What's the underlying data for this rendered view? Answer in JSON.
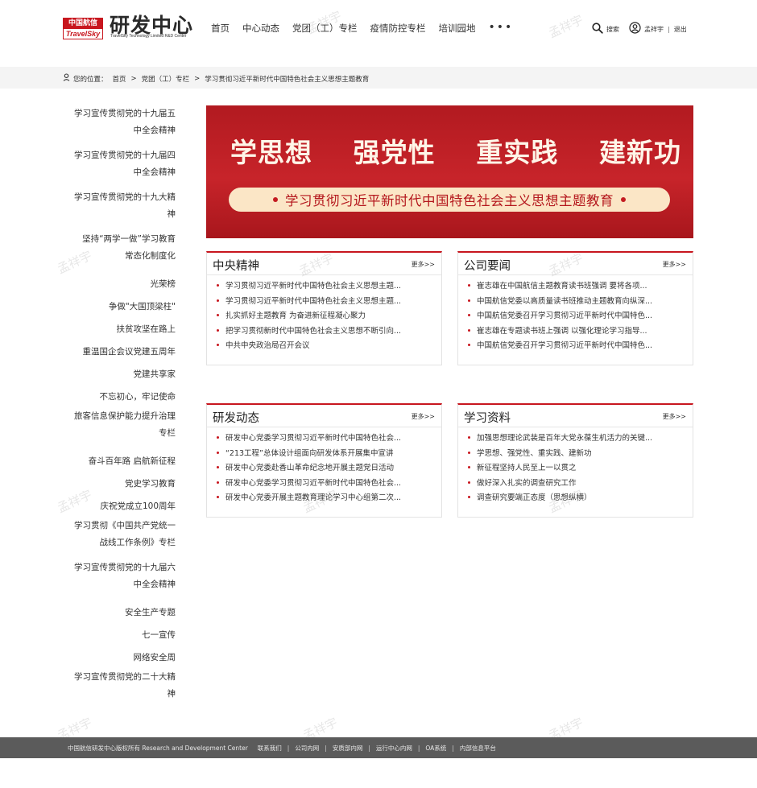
{
  "header": {
    "logo_top": "中国航信",
    "logo_bottom": "TravelSky",
    "brand_title": "研发中心",
    "brand_subtitle": "TravelSky Technology Limited R&D Center",
    "nav": [
      "首页",
      "中心动态",
      "党团（工）专栏",
      "疫情防控专栏",
      "培训园地"
    ],
    "nav_more": "•••",
    "search_label": "搜索",
    "user_name": "孟祥宇",
    "logout_label": "退出"
  },
  "breadcrumb": {
    "prefix": "您的位置：",
    "items": [
      "首页",
      "党团（工）专栏",
      "学习贯彻习近平新时代中国特色社会主义思想主题教育"
    ],
    "separator": ">"
  },
  "sidebar": {
    "items": [
      {
        "line1": "学习宣传贯彻党的十九届五",
        "line2": "中全会精神"
      },
      {
        "line1": "学习宣传贯彻党的十九届四",
        "line2": "中全会精神"
      },
      {
        "line1": "学习宣传贯彻党的十九大精",
        "line2": "神"
      },
      {
        "line1": "坚持“两学一做”学习教育",
        "line2": "常态化制度化"
      },
      {
        "line1": "光荣榜",
        "line2": ""
      },
      {
        "line1": "争做\"大国顶梁柱\"",
        "line2": ""
      },
      {
        "line1": "扶贫攻坚在路上",
        "line2": ""
      },
      {
        "line1": "重温国企会议党建五周年",
        "line2": ""
      },
      {
        "line1": "党建共享家",
        "line2": ""
      },
      {
        "line1": "不忘初心，牢记使命",
        "line2": ""
      },
      {
        "line1": "旅客信息保护能力提升治理",
        "line2": "专栏"
      },
      {
        "line1": "奋斗百年路 启航新征程",
        "line2": ""
      },
      {
        "line1": "党史学习教育",
        "line2": ""
      },
      {
        "line1": "庆祝党成立100周年",
        "line2": ""
      },
      {
        "line1": "学习贯彻《中国共产党统一",
        "line2": "战线工作条例》专栏"
      },
      {
        "line1": "学习宣传贯彻党的十九届六",
        "line2": "中全会精神"
      },
      {
        "line1": "安全生产专题",
        "line2": ""
      },
      {
        "line1": "七一宣传",
        "line2": ""
      },
      {
        "line1": "网络安全周",
        "line2": ""
      },
      {
        "line1": "学习宣传贯彻党的二十大精",
        "line2": "神"
      }
    ]
  },
  "banner": {
    "words": [
      "学思想",
      "强党性",
      "重实践",
      "建新功"
    ],
    "subtitle": "学习贯彻习近平新时代中国特色社会主义思想主题教育"
  },
  "panels": {
    "central": {
      "title": "中央精神",
      "more": "更多>>",
      "items": [
        "学习贯彻习近平新时代中国特色社会主义思想主题...",
        "学习贯彻习近平新时代中国特色社会主义思想主题...",
        "扎实抓好主题教育 为奋进新征程凝心聚力",
        "把学习贯彻新时代中国特色社会主义思想不断引向...",
        "中共中央政治局召开会议"
      ]
    },
    "company": {
      "title": "公司要闻",
      "more": "更多>>",
      "items": [
        "崔志雄在中国航信主题教育读书班强调 要将各项...",
        "中国航信党委以高质量读书班推动主题教育向纵深...",
        "中国航信党委召开学习贯彻习近平新时代中国特色...",
        "崔志雄在专题读书班上强调 以强化理论学习指导...",
        "中国航信党委召开学习贯彻习近平新时代中国特色..."
      ]
    },
    "rd": {
      "title": "研发动态",
      "more": "更多>>",
      "items": [
        "研发中心党委学习贯彻习近平新时代中国特色社会...",
        "“213工程”总体设计组面向研发体系开展集中宣讲",
        "研发中心党委赴香山革命纪念地开展主题党日活动",
        "研发中心党委学习贯彻习近平新时代中国特色社会...",
        "研发中心党委开展主题教育理论学习中心组第二次..."
      ]
    },
    "study": {
      "title": "学习资料",
      "more": "更多>>",
      "items": [
        "加强思想理论武装是百年大党永葆生机活力的关键...",
        "学思想、强党性、重实践、建新功",
        "新征程坚持人民至上一以贯之",
        "做好深入扎实的调查研究工作",
        "调查研究要端正态度（思想纵横）"
      ]
    }
  },
  "watermark": "孟祥宇",
  "footer": {
    "copyright": "中国航信研发中心版权所有 Research and Development Center",
    "links": [
      "联系我们",
      "公司内网",
      "安质部内网",
      "运行中心内网",
      "OA系统",
      "内部信息平台"
    ]
  },
  "colors": {
    "accent": "#c8161e",
    "footer_bg": "#5b5b5b",
    "crumb_bg": "#f4f4f4"
  }
}
